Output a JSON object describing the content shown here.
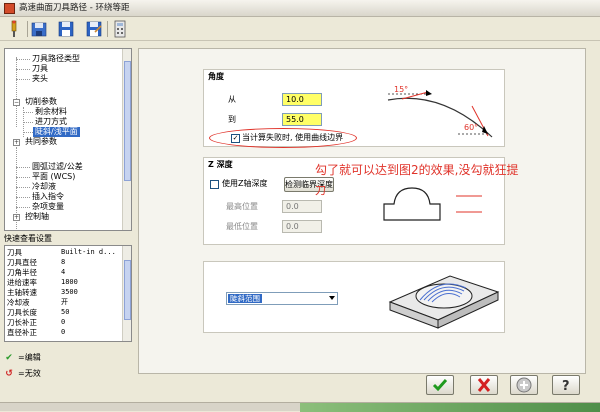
{
  "window": {
    "title": "高速曲面刀具路径 - 环绕等距"
  },
  "tree": {
    "items": [
      {
        "label": "刀具路径类型"
      },
      {
        "label": "刀具"
      },
      {
        "label": "夹头"
      },
      {
        "label": "切削参数"
      },
      {
        "label": "剩余材料"
      },
      {
        "label": "进刀方式"
      },
      {
        "label": "陡斜/浅平面"
      },
      {
        "label": "共同参数"
      },
      {
        "label": "圆弧过滤/公差"
      },
      {
        "label": "平面 (WCS)"
      },
      {
        "label": "冷却液"
      },
      {
        "label": "插入指令"
      },
      {
        "label": "杂项变量"
      },
      {
        "label": "控制轴"
      }
    ]
  },
  "quickview": {
    "title": "快速查看设置",
    "rows": [
      {
        "key": "刀具",
        "value": "Built-in d..."
      },
      {
        "key": "刀具直径",
        "value": "8"
      },
      {
        "key": "刀角半径",
        "value": "4"
      },
      {
        "key": "进给速率",
        "value": "1800"
      },
      {
        "key": "主轴转速",
        "value": "3500"
      },
      {
        "key": "冷却液",
        "value": "开"
      },
      {
        "key": "刀具长度",
        "value": "50"
      },
      {
        "key": "刀长补正",
        "value": "0"
      },
      {
        "key": "直径补正",
        "value": "0"
      }
    ]
  },
  "legend": {
    "edit": "=编辑",
    "invalid": "=无效"
  },
  "angle": {
    "title": "角度",
    "from_label": "从",
    "from_value": "10.0",
    "to_label": "到",
    "to_value": "55.0",
    "boundary_checkbox": "当计算失败时, 使用曲线边界",
    "diagram_top": "15°",
    "diagram_bottom": "60°"
  },
  "zdepth": {
    "title": "Z 深度",
    "use_checkbox": "使用Z轴深度",
    "detect_button": "检测临界深度",
    "max_label": "最高位置",
    "max_value": "0.0",
    "min_label": "最低位置",
    "min_value": "0.0"
  },
  "range": {
    "selected": "陡斜范围"
  },
  "annotation": {
    "text": "勾了就可以达到图2的效果,没勾就狂提",
    "text2": "刀"
  },
  "colors": {
    "annotation": "#e0332a",
    "highlight": "#316ac5",
    "input_yellow": "#ffff66"
  }
}
